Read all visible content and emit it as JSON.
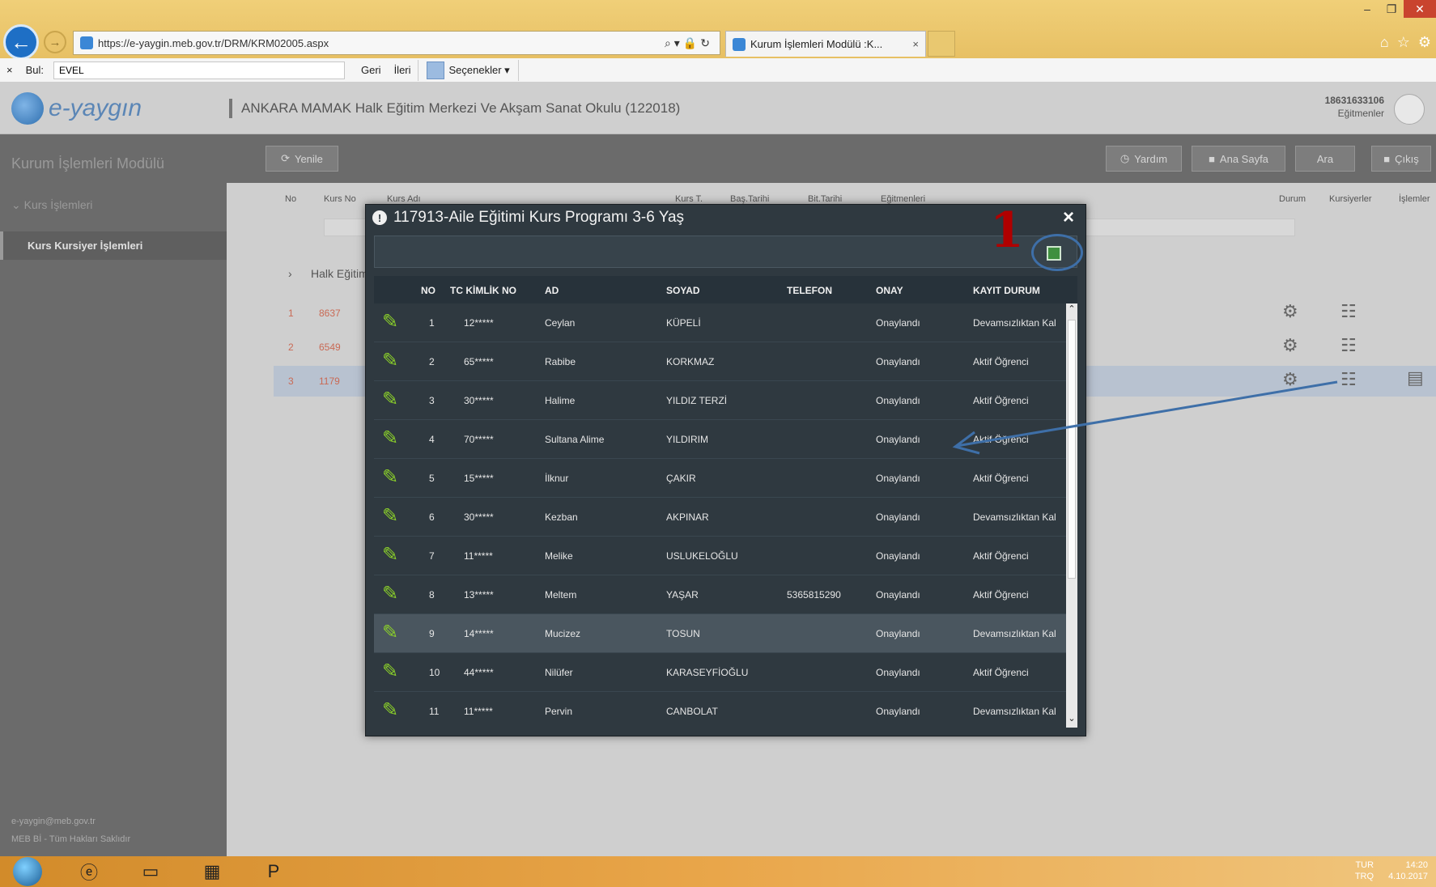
{
  "browser": {
    "url": "https://e-yaygin.meb.gov.tr/DRM/KRM02005.aspx",
    "tab_title": "Kurum İşlemleri Modülü :K...",
    "tab_close": "×",
    "window_controls": {
      "minimize": "–",
      "restore": "❐",
      "close": "✕"
    }
  },
  "findbar": {
    "close": "×",
    "label": "Bul:",
    "value": "EVEL",
    "prev": "Geri",
    "next": "İleri",
    "options": "Seçenekler ▾"
  },
  "app": {
    "logo_text": "e-yaygın",
    "school": "ANKARA MAMAK Halk Eğitim Merkezi Ve Akşam Sanat Okulu (122018)",
    "user_id": "18631633106",
    "user_role": "Eğitmenler"
  },
  "sidebar": {
    "module_title": "Kurum İşlemleri Modülü",
    "group": "Kurs İşlemleri",
    "item": "Kurs Kursiyer İşlemleri",
    "footer_email": "e-yaygin@meb.gov.tr",
    "footer_copy": "MEB Bİ - Tüm Hakları Saklıdır"
  },
  "toolbar": {
    "refresh": "Yenile",
    "help": "Yardım",
    "home": "Ana Sayfa",
    "search": "Ara",
    "logout": "Çıkış"
  },
  "main": {
    "headers": [
      "No",
      "Kurs No",
      "Kurs Adı",
      "Kurs T.",
      "Baş.Tarihi",
      "Bit.Tarihi",
      "Eğitmenleri",
      "Durum",
      "Kursiyerler",
      "İşlemler"
    ],
    "section_title": "Halk Eğitim M",
    "rows": [
      {
        "no": "1",
        "code": "8637"
      },
      {
        "no": "2",
        "code": "6549"
      },
      {
        "no": "3",
        "code": "1179"
      }
    ]
  },
  "modal": {
    "title": "117913-Aile Eğitimi Kurs Programı 3-6 Yaş",
    "close": "×",
    "annotation": "1",
    "columns": [
      "NO",
      "TC KİMLİK NO",
      "AD",
      "SOYAD",
      "TELEFON",
      "ONAY",
      "KAYIT DURUM"
    ],
    "rows": [
      {
        "no": "1",
        "tc": "12*****",
        "ad": "Ceylan",
        "soyad": "KÜPELİ",
        "telefon": "",
        "onay": "Onaylandı",
        "durum": "Devamsızlıktan Kal"
      },
      {
        "no": "2",
        "tc": "65*****",
        "ad": "Rabibe",
        "soyad": "KORKMAZ",
        "telefon": "",
        "onay": "Onaylandı",
        "durum": "Aktif Öğrenci"
      },
      {
        "no": "3",
        "tc": "30*****",
        "ad": "Halime",
        "soyad": "YILDIZ TERZİ",
        "telefon": "",
        "onay": "Onaylandı",
        "durum": "Aktif Öğrenci"
      },
      {
        "no": "4",
        "tc": "70*****",
        "ad": "Sultana Alime",
        "soyad": "YILDIRIM",
        "telefon": "",
        "onay": "Onaylandı",
        "durum": "Aktif Öğrenci"
      },
      {
        "no": "5",
        "tc": "15*****",
        "ad": "İlknur",
        "soyad": "ÇAKIR",
        "telefon": "",
        "onay": "Onaylandı",
        "durum": "Aktif Öğrenci"
      },
      {
        "no": "6",
        "tc": "30*****",
        "ad": "Kezban",
        "soyad": "AKPINAR",
        "telefon": "",
        "onay": "Onaylandı",
        "durum": "Devamsızlıktan Kal"
      },
      {
        "no": "7",
        "tc": "11*****",
        "ad": "Melike",
        "soyad": "USLUKELOĞLU",
        "telefon": "",
        "onay": "Onaylandı",
        "durum": "Aktif Öğrenci"
      },
      {
        "no": "8",
        "tc": "13*****",
        "ad": "Meltem",
        "soyad": "YAŞAR",
        "telefon": "5365815290",
        "onay": "Onaylandı",
        "durum": "Aktif Öğrenci"
      },
      {
        "no": "9",
        "tc": "14*****",
        "ad": "Mucizez",
        "soyad": "TOSUN",
        "telefon": "",
        "onay": "Onaylandı",
        "durum": "Devamsızlıktan Kal"
      },
      {
        "no": "10",
        "tc": "44*****",
        "ad": "Nilüfer",
        "soyad": "KARASEYFİOĞLU",
        "telefon": "",
        "onay": "Onaylandı",
        "durum": "Aktif Öğrenci"
      },
      {
        "no": "11",
        "tc": "11*****",
        "ad": "Pervin",
        "soyad": "CANBOLAT",
        "telefon": "",
        "onay": "Onaylandı",
        "durum": "Devamsızlıktan Kal"
      }
    ]
  },
  "taskbar": {
    "lang": "TUR",
    "time": "14:20",
    "date": "4.10.2017",
    "region": "TRQ"
  },
  "colors": {
    "modal_bg": "#2f3940",
    "edit_icon": "#8bd02a",
    "annotation": "#b00000",
    "annotation_arrow": "#3e6fa8"
  }
}
